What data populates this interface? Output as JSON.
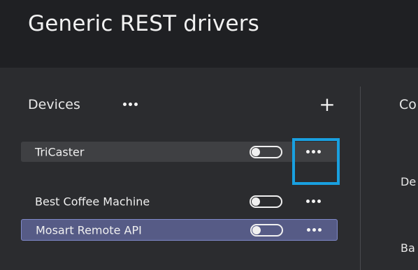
{
  "header": {
    "title": "Generic REST drivers"
  },
  "devices_panel": {
    "title": "Devices",
    "add_label": "+",
    "items": [
      {
        "label": "TriCaster",
        "enabled": false,
        "state": "hover"
      },
      {
        "label": "Best Coffee Machine",
        "enabled": false,
        "state": "normal"
      },
      {
        "label": "Mosart Remote API",
        "enabled": false,
        "state": "selected"
      }
    ]
  },
  "right_panel": {
    "title_fragment": "Co",
    "field1_fragment": "De",
    "field2_fragment": "Ba"
  },
  "colors": {
    "header_bg": "#1f2023",
    "panel_bg": "#2b2c2f",
    "row_hover": "#3f4043",
    "row_selected": "#565b86",
    "highlight": "#19a0e0"
  },
  "icons": {
    "more": "more-horizontal-icon",
    "add": "plus-icon",
    "toggle": "toggle-off-icon"
  }
}
